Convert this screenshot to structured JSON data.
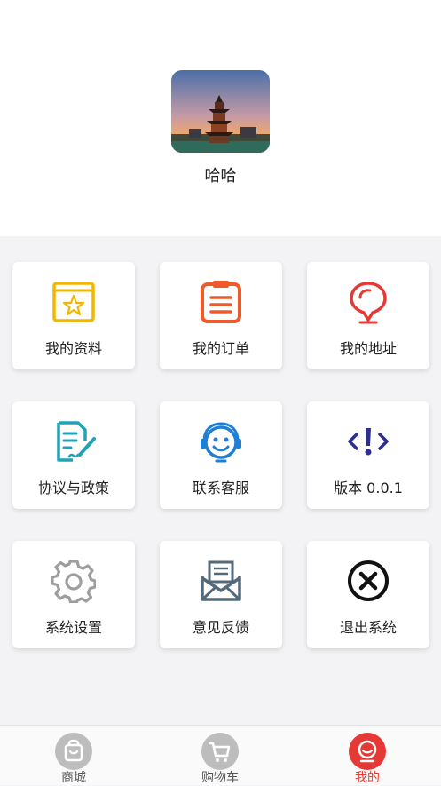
{
  "profile": {
    "username": "哈哈"
  },
  "menu": [
    {
      "label": "我的资料",
      "icon": "profile-card-icon",
      "color": "#f2b600"
    },
    {
      "label": "我的订单",
      "icon": "order-list-icon",
      "color": "#f05a28"
    },
    {
      "label": "我的地址",
      "icon": "location-pin-icon",
      "color": "#e53935"
    },
    {
      "label": "协议与政策",
      "icon": "document-sign-icon",
      "color": "#1fa3b5"
    },
    {
      "label": "联系客服",
      "icon": "customer-service-icon",
      "color": "#1e7fd6"
    },
    {
      "label": "版本 0.0.1",
      "icon": "version-info-icon",
      "color": "#2b2f8f"
    },
    {
      "label": "系统设置",
      "icon": "gear-icon",
      "color": "#9e9e9e"
    },
    {
      "label": "意见反馈",
      "icon": "feedback-mail-icon",
      "color": "#546a7b"
    },
    {
      "label": "退出系统",
      "icon": "close-circle-icon",
      "color": "#111111"
    }
  ],
  "tabs": [
    {
      "label": "商城",
      "icon": "shopping-bag-icon",
      "active": false
    },
    {
      "label": "购物车",
      "icon": "cart-icon",
      "active": false
    },
    {
      "label": "我的",
      "icon": "user-icon",
      "active": true
    }
  ],
  "colors": {
    "accent": "#e53935",
    "inactive": "#bdbdbd"
  }
}
